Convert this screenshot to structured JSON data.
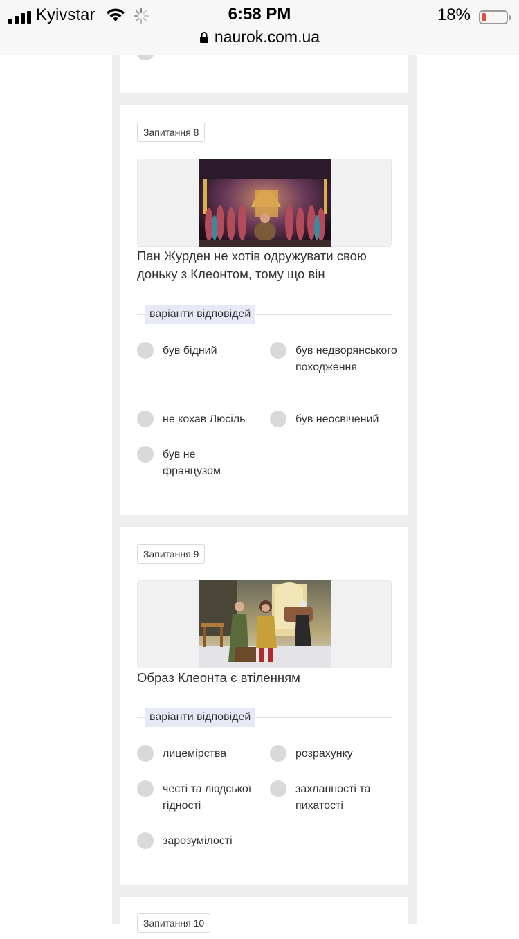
{
  "status_bar": {
    "carrier": "Kyivstar",
    "time": "6:58 PM",
    "battery": "18%",
    "battery_level": 0.18
  },
  "url_bar": {
    "domain": "naurok.com.ua"
  },
  "questions": [
    {
      "badge": "Запитання 8",
      "text": "Пан Журден не хотів одружувати свою доньку з Клеонтом, тому що він",
      "variants_label": "варіанти відповідей",
      "options": [
        "був бідний",
        "був недворянського походження",
        "не кохав Люсіль",
        "був неосвічений",
        "був не французом"
      ]
    },
    {
      "badge": "Запитання 9",
      "text": "Образ Клеонта є втіленням",
      "variants_label": "варіанти відповідей",
      "options": [
        "лицемірства",
        "розрахунку",
        "честі та людської гідності",
        "захланності та пихатості",
        "зарозумілості"
      ]
    },
    {
      "badge": "Запитання 10"
    }
  ]
}
